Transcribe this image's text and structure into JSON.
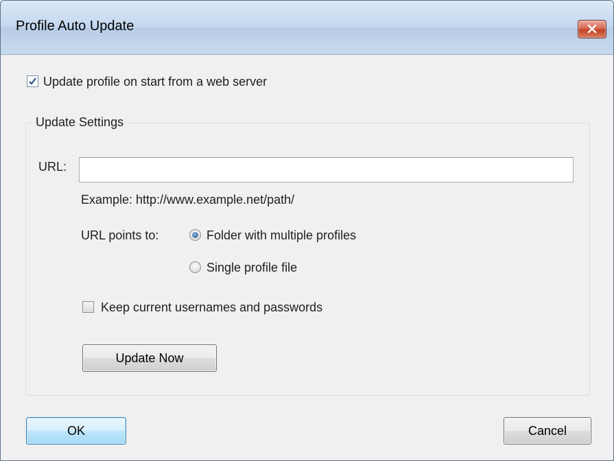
{
  "window": {
    "title": "Profile Auto Update"
  },
  "auto_update": {
    "label": "Update profile on start from a web server",
    "checked": true
  },
  "group": {
    "title": "Update Settings",
    "url_label": "URL:",
    "url_value": "",
    "url_example": "Example: http://www.example.net/path/",
    "points_to_label": "URL points to:",
    "options": [
      {
        "label": "Folder with multiple profiles",
        "selected": true
      },
      {
        "label": "Single profile file",
        "selected": false
      }
    ],
    "keep_credentials": {
      "label": "Keep current usernames and passwords",
      "checked": false
    },
    "update_now_label": "Update Now"
  },
  "footer": {
    "ok_label": "OK",
    "cancel_label": "Cancel"
  },
  "icons": {
    "close": "close-icon",
    "checkmark": "checkmark-icon"
  },
  "colors": {
    "close_button": "#c2422a",
    "default_button_border": "#3c7fb1",
    "radio_dot": "#1f4e8c"
  }
}
